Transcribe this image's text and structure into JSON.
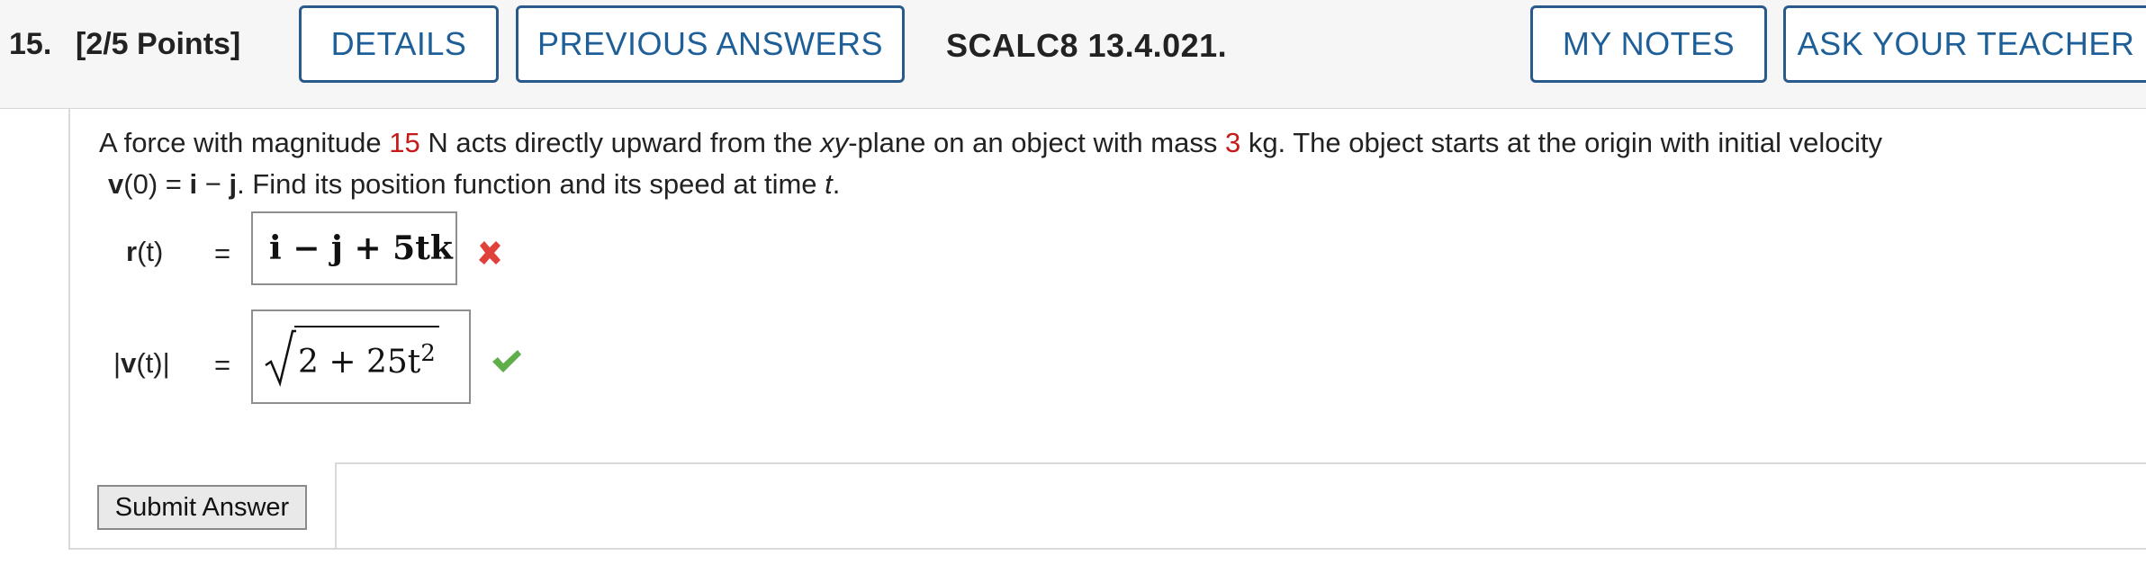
{
  "header": {
    "question_number": "15.",
    "points": "[2/5 Points]",
    "details_label": "DETAILS",
    "previous_answers_label": "PREVIOUS ANSWERS",
    "reference": "SCALC8 13.4.021.",
    "my_notes_label": "MY NOTES",
    "ask_teacher_label": "ASK YOUR TEACHER"
  },
  "problem": {
    "text_1": "A force with magnitude ",
    "magnitude": "15",
    "text_2": " N acts directly upward from the ",
    "xy": "xy",
    "text_3": "-plane on an object with mass ",
    "mass": "3",
    "text_4": " kg. The object starts at the origin with initial velocity",
    "v0_bold": "v",
    "v0_rest": "(0) = ",
    "i": "i",
    "minus": " − ",
    "j": "j",
    "text_5": ".  Find its position function and its speed at time ",
    "t": "t",
    "period": "."
  },
  "answers": {
    "r_label_bold": "r",
    "r_label_rest": "(t)",
    "v_label_pre": "|",
    "v_label_bold": "v",
    "v_label_rest": "(t)|",
    "equals": "=",
    "r_answer": "i − j + 5tk",
    "v_answer_radicand": "2 + 25t",
    "v_answer_exp": "2",
    "r_status": "incorrect",
    "v_status": "correct"
  },
  "colors": {
    "accent": "#1f5f98",
    "highlight_red": "#c61a1a",
    "incorrect": "#e0413a",
    "correct": "#5fae4a"
  },
  "submit": {
    "label": "Submit Answer"
  }
}
